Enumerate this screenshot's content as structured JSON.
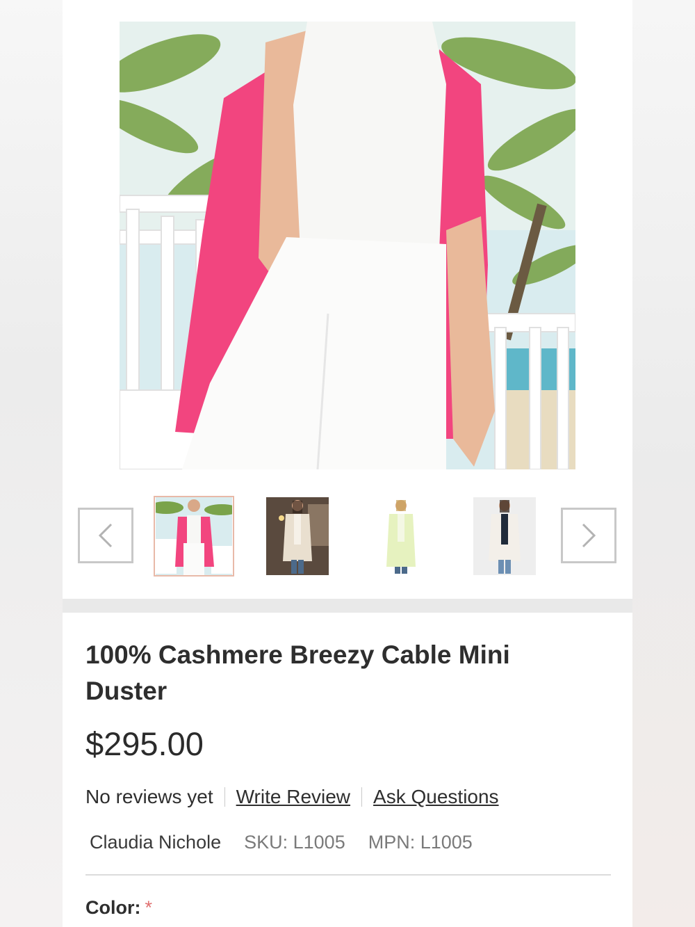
{
  "product": {
    "title": "100% Cashmere Breezy Cable Mini Duster",
    "price": "$295.00",
    "reviews_text": "No reviews yet",
    "write_review": "Write Review",
    "ask_questions": "Ask Questions",
    "brand": "Claudia Nichole",
    "sku": "SKU: L1005",
    "mpn": "MPN: L1005",
    "color_label": "Color:",
    "required_mark": "*"
  },
  "gallery": {
    "prev_icon": "chevron-left-icon",
    "next_icon": "chevron-right-icon",
    "selected_index": 0,
    "thumbnails": [
      "pink-duster-thumbnail",
      "cream-duster-thumbnail",
      "lime-duster-thumbnail",
      "white-duster-thumbnail"
    ]
  },
  "colors": {
    "accent_pink": "#f2457f",
    "active_thumb_border": "#e8b9a8",
    "required": "#e07070"
  }
}
